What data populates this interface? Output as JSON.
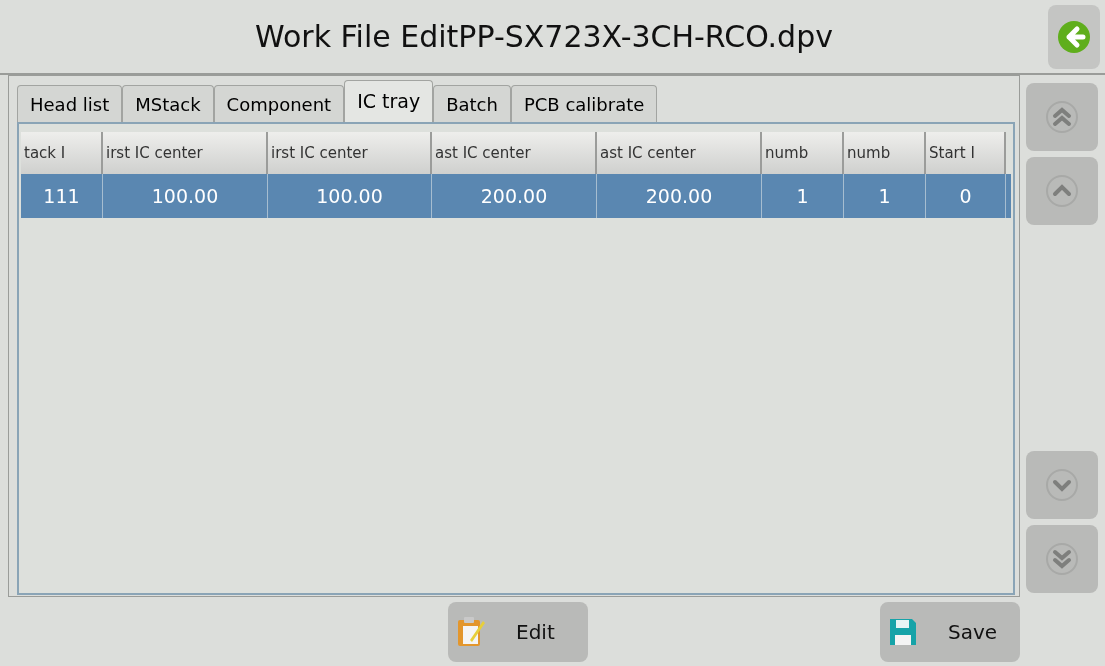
{
  "window": {
    "title": "Work File EditPP-SX723X-3CH-RCO.dpv"
  },
  "tabs": [
    {
      "label": "Head list",
      "selected": false
    },
    {
      "label": "MStack",
      "selected": false
    },
    {
      "label": "Component",
      "selected": false
    },
    {
      "label": "IC tray",
      "selected": true
    },
    {
      "label": "Batch",
      "selected": false
    },
    {
      "label": "PCB calibrate",
      "selected": false
    }
  ],
  "table": {
    "columns": [
      "tack I",
      "irst IC center",
      "irst IC center",
      "ast IC center",
      "ast IC center",
      "numb",
      "numb",
      "Start I"
    ],
    "rows": [
      {
        "selected": true,
        "cells": [
          "111",
          "100.00",
          "100.00",
          "200.00",
          "200.00",
          "1",
          "1",
          "0"
        ]
      }
    ]
  },
  "buttons": [
    {
      "kind": "edit",
      "label": "Edit"
    },
    {
      "kind": "save",
      "label": "Save"
    }
  ]
}
